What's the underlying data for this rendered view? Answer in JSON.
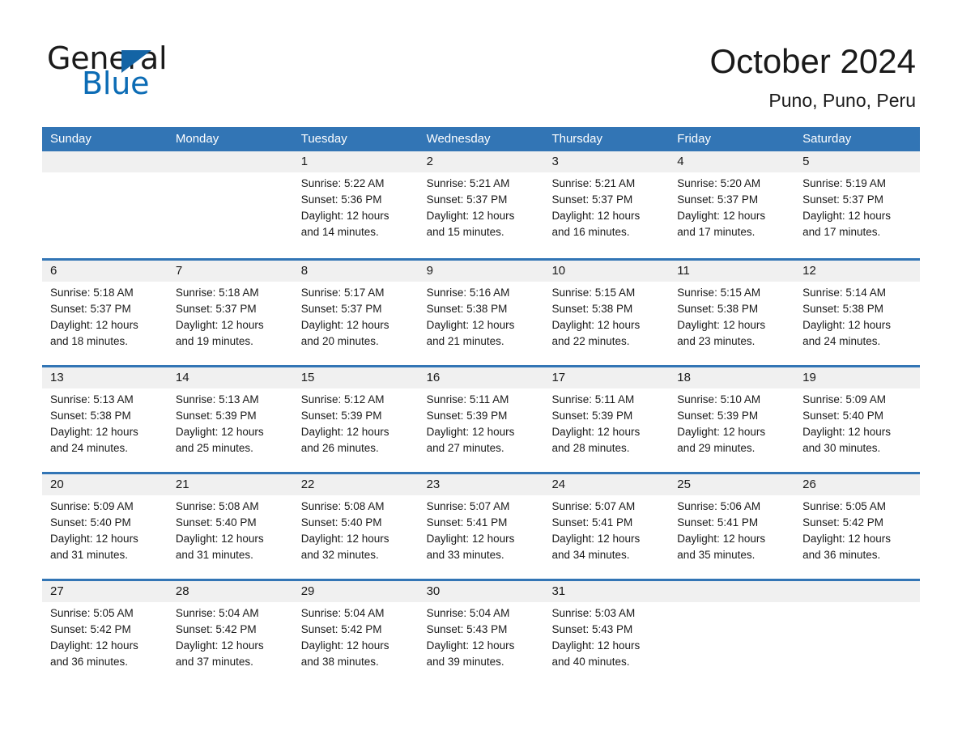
{
  "brand": {
    "name_line1": "General",
    "name_line2": "Blue",
    "logo_icon": "triangle-logo-icon",
    "accent_color": "#0c6cb5"
  },
  "header": {
    "title": "October 2024",
    "location": "Puno, Puno, Peru"
  },
  "theme": {
    "header_blue": "#3275b5",
    "row_divider_blue": "#3275b5",
    "daynum_band": "#f0f0f0",
    "text": "#1a1a1a"
  },
  "calendar": {
    "weekdays": [
      "Sunday",
      "Monday",
      "Tuesday",
      "Wednesday",
      "Thursday",
      "Friday",
      "Saturday"
    ],
    "weeks": [
      [
        {
          "day": "",
          "sunrise": "",
          "sunset": "",
          "daylight_line1": "",
          "daylight_line2": "",
          "empty": true
        },
        {
          "day": "",
          "sunrise": "",
          "sunset": "",
          "daylight_line1": "",
          "daylight_line2": "",
          "empty": true
        },
        {
          "day": "1",
          "sunrise": "Sunrise: 5:22 AM",
          "sunset": "Sunset: 5:36 PM",
          "daylight_line1": "Daylight: 12 hours",
          "daylight_line2": "and 14 minutes."
        },
        {
          "day": "2",
          "sunrise": "Sunrise: 5:21 AM",
          "sunset": "Sunset: 5:37 PM",
          "daylight_line1": "Daylight: 12 hours",
          "daylight_line2": "and 15 minutes."
        },
        {
          "day": "3",
          "sunrise": "Sunrise: 5:21 AM",
          "sunset": "Sunset: 5:37 PM",
          "daylight_line1": "Daylight: 12 hours",
          "daylight_line2": "and 16 minutes."
        },
        {
          "day": "4",
          "sunrise": "Sunrise: 5:20 AM",
          "sunset": "Sunset: 5:37 PM",
          "daylight_line1": "Daylight: 12 hours",
          "daylight_line2": "and 17 minutes."
        },
        {
          "day": "5",
          "sunrise": "Sunrise: 5:19 AM",
          "sunset": "Sunset: 5:37 PM",
          "daylight_line1": "Daylight: 12 hours",
          "daylight_line2": "and 17 minutes."
        }
      ],
      [
        {
          "day": "6",
          "sunrise": "Sunrise: 5:18 AM",
          "sunset": "Sunset: 5:37 PM",
          "daylight_line1": "Daylight: 12 hours",
          "daylight_line2": "and 18 minutes."
        },
        {
          "day": "7",
          "sunrise": "Sunrise: 5:18 AM",
          "sunset": "Sunset: 5:37 PM",
          "daylight_line1": "Daylight: 12 hours",
          "daylight_line2": "and 19 minutes."
        },
        {
          "day": "8",
          "sunrise": "Sunrise: 5:17 AM",
          "sunset": "Sunset: 5:37 PM",
          "daylight_line1": "Daylight: 12 hours",
          "daylight_line2": "and 20 minutes."
        },
        {
          "day": "9",
          "sunrise": "Sunrise: 5:16 AM",
          "sunset": "Sunset: 5:38 PM",
          "daylight_line1": "Daylight: 12 hours",
          "daylight_line2": "and 21 minutes."
        },
        {
          "day": "10",
          "sunrise": "Sunrise: 5:15 AM",
          "sunset": "Sunset: 5:38 PM",
          "daylight_line1": "Daylight: 12 hours",
          "daylight_line2": "and 22 minutes."
        },
        {
          "day": "11",
          "sunrise": "Sunrise: 5:15 AM",
          "sunset": "Sunset: 5:38 PM",
          "daylight_line1": "Daylight: 12 hours",
          "daylight_line2": "and 23 minutes."
        },
        {
          "day": "12",
          "sunrise": "Sunrise: 5:14 AM",
          "sunset": "Sunset: 5:38 PM",
          "daylight_line1": "Daylight: 12 hours",
          "daylight_line2": "and 24 minutes."
        }
      ],
      [
        {
          "day": "13",
          "sunrise": "Sunrise: 5:13 AM",
          "sunset": "Sunset: 5:38 PM",
          "daylight_line1": "Daylight: 12 hours",
          "daylight_line2": "and 24 minutes."
        },
        {
          "day": "14",
          "sunrise": "Sunrise: 5:13 AM",
          "sunset": "Sunset: 5:39 PM",
          "daylight_line1": "Daylight: 12 hours",
          "daylight_line2": "and 25 minutes."
        },
        {
          "day": "15",
          "sunrise": "Sunrise: 5:12 AM",
          "sunset": "Sunset: 5:39 PM",
          "daylight_line1": "Daylight: 12 hours",
          "daylight_line2": "and 26 minutes."
        },
        {
          "day": "16",
          "sunrise": "Sunrise: 5:11 AM",
          "sunset": "Sunset: 5:39 PM",
          "daylight_line1": "Daylight: 12 hours",
          "daylight_line2": "and 27 minutes."
        },
        {
          "day": "17",
          "sunrise": "Sunrise: 5:11 AM",
          "sunset": "Sunset: 5:39 PM",
          "daylight_line1": "Daylight: 12 hours",
          "daylight_line2": "and 28 minutes."
        },
        {
          "day": "18",
          "sunrise": "Sunrise: 5:10 AM",
          "sunset": "Sunset: 5:39 PM",
          "daylight_line1": "Daylight: 12 hours",
          "daylight_line2": "and 29 minutes."
        },
        {
          "day": "19",
          "sunrise": "Sunrise: 5:09 AM",
          "sunset": "Sunset: 5:40 PM",
          "daylight_line1": "Daylight: 12 hours",
          "daylight_line2": "and 30 minutes."
        }
      ],
      [
        {
          "day": "20",
          "sunrise": "Sunrise: 5:09 AM",
          "sunset": "Sunset: 5:40 PM",
          "daylight_line1": "Daylight: 12 hours",
          "daylight_line2": "and 31 minutes."
        },
        {
          "day": "21",
          "sunrise": "Sunrise: 5:08 AM",
          "sunset": "Sunset: 5:40 PM",
          "daylight_line1": "Daylight: 12 hours",
          "daylight_line2": "and 31 minutes."
        },
        {
          "day": "22",
          "sunrise": "Sunrise: 5:08 AM",
          "sunset": "Sunset: 5:40 PM",
          "daylight_line1": "Daylight: 12 hours",
          "daylight_line2": "and 32 minutes."
        },
        {
          "day": "23",
          "sunrise": "Sunrise: 5:07 AM",
          "sunset": "Sunset: 5:41 PM",
          "daylight_line1": "Daylight: 12 hours",
          "daylight_line2": "and 33 minutes."
        },
        {
          "day": "24",
          "sunrise": "Sunrise: 5:07 AM",
          "sunset": "Sunset: 5:41 PM",
          "daylight_line1": "Daylight: 12 hours",
          "daylight_line2": "and 34 minutes."
        },
        {
          "day": "25",
          "sunrise": "Sunrise: 5:06 AM",
          "sunset": "Sunset: 5:41 PM",
          "daylight_line1": "Daylight: 12 hours",
          "daylight_line2": "and 35 minutes."
        },
        {
          "day": "26",
          "sunrise": "Sunrise: 5:05 AM",
          "sunset": "Sunset: 5:42 PM",
          "daylight_line1": "Daylight: 12 hours",
          "daylight_line2": "and 36 minutes."
        }
      ],
      [
        {
          "day": "27",
          "sunrise": "Sunrise: 5:05 AM",
          "sunset": "Sunset: 5:42 PM",
          "daylight_line1": "Daylight: 12 hours",
          "daylight_line2": "and 36 minutes."
        },
        {
          "day": "28",
          "sunrise": "Sunrise: 5:04 AM",
          "sunset": "Sunset: 5:42 PM",
          "daylight_line1": "Daylight: 12 hours",
          "daylight_line2": "and 37 minutes."
        },
        {
          "day": "29",
          "sunrise": "Sunrise: 5:04 AM",
          "sunset": "Sunset: 5:42 PM",
          "daylight_line1": "Daylight: 12 hours",
          "daylight_line2": "and 38 minutes."
        },
        {
          "day": "30",
          "sunrise": "Sunrise: 5:04 AM",
          "sunset": "Sunset: 5:43 PM",
          "daylight_line1": "Daylight: 12 hours",
          "daylight_line2": "and 39 minutes."
        },
        {
          "day": "31",
          "sunrise": "Sunrise: 5:03 AM",
          "sunset": "Sunset: 5:43 PM",
          "daylight_line1": "Daylight: 12 hours",
          "daylight_line2": "and 40 minutes."
        },
        {
          "day": "",
          "sunrise": "",
          "sunset": "",
          "daylight_line1": "",
          "daylight_line2": "",
          "empty": true
        },
        {
          "day": "",
          "sunrise": "",
          "sunset": "",
          "daylight_line1": "",
          "daylight_line2": "",
          "empty": true
        }
      ]
    ]
  }
}
